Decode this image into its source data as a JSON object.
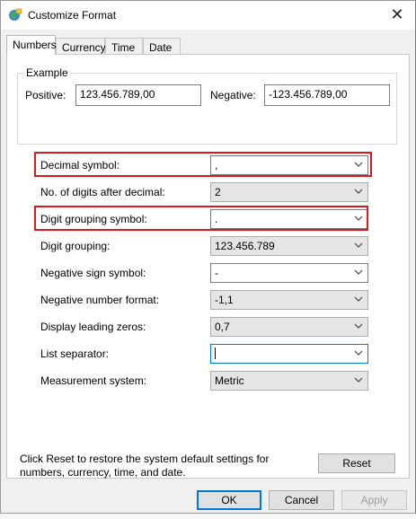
{
  "window": {
    "title": "Customize Format",
    "close_label": "✕"
  },
  "tabs": [
    {
      "label": "Numbers"
    },
    {
      "label": "Currency"
    },
    {
      "label": "Time"
    },
    {
      "label": "Date"
    }
  ],
  "example": {
    "title": "Example",
    "positive_label": "Positive:",
    "positive_value": "123.456.789,00",
    "negative_label": "Negative:",
    "negative_value": "-123.456.789,00"
  },
  "settings": [
    {
      "label": "Decimal symbol:",
      "value": ",",
      "editable": true,
      "highlighted": true
    },
    {
      "label": "No. of digits after decimal:",
      "value": "2",
      "editable": false
    },
    {
      "label": "Digit grouping symbol:",
      "value": ".",
      "editable": true,
      "highlighted": true
    },
    {
      "label": "Digit grouping:",
      "value": "123.456.789",
      "editable": false
    },
    {
      "label": "Negative sign symbol:",
      "value": "-",
      "editable": true
    },
    {
      "label": "Negative number format:",
      "value": "-1,1",
      "editable": false
    },
    {
      "label": "Display leading zeros:",
      "value": "0,7",
      "editable": false
    },
    {
      "label": "List separator:",
      "value": "",
      "editable": true,
      "focused": true
    },
    {
      "label": "Measurement system:",
      "value": "Metric",
      "editable": false
    }
  ],
  "footer": {
    "reset_text_line1": "Click Reset to restore the system default settings for",
    "reset_text_line2": "numbers, currency, time, and date.",
    "reset_label": "Reset",
    "ok_label": "OK",
    "cancel_label": "Cancel",
    "apply_label": "Apply"
  },
  "colors": {
    "highlight": "#d71921",
    "focus": "#0078d7"
  }
}
